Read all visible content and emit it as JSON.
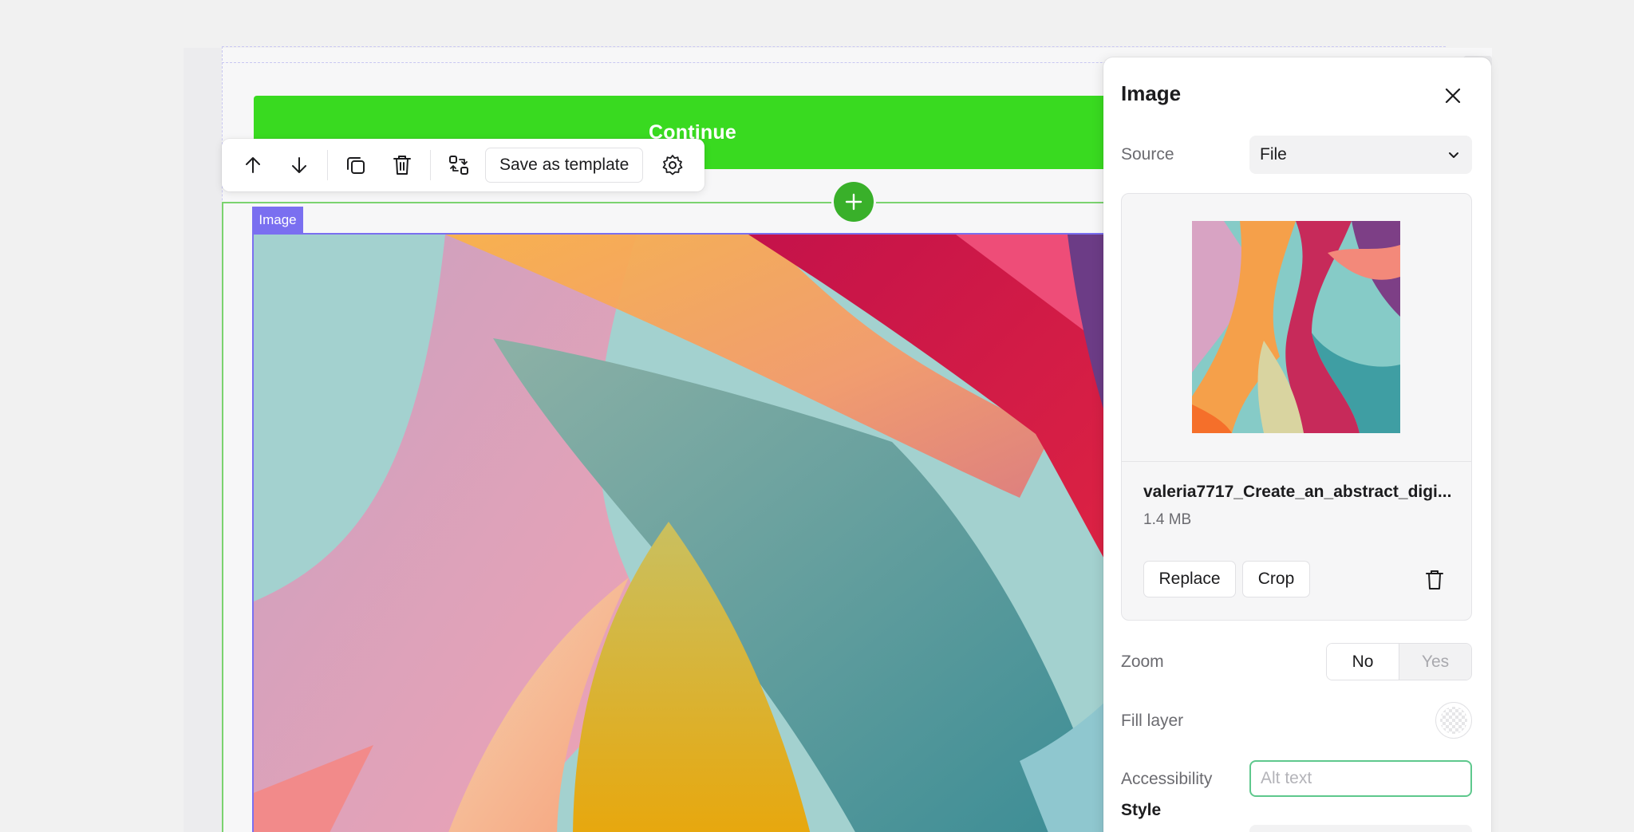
{
  "canvas": {
    "continue_label": "Continue",
    "image_tag": "Image"
  },
  "toolbar": {
    "save_template_label": "Save as template",
    "icons": [
      "arrow-up-icon",
      "arrow-down-icon",
      "duplicate-icon",
      "trash-icon",
      "swap-icon",
      "gear-icon"
    ]
  },
  "panel": {
    "title": "Image",
    "source_label": "Source",
    "source_value": "File",
    "file": {
      "name": "valeria7717_Create_an_abstract_digi...",
      "size": "1.4 MB",
      "replace_label": "Replace",
      "crop_label": "Crop"
    },
    "zoom_label": "Zoom",
    "zoom_options": [
      "No",
      "Yes"
    ],
    "zoom_selected": "No",
    "fill_layer_label": "Fill layer",
    "accessibility_label": "Accessibility",
    "alt_text_placeholder": "Alt text",
    "alt_text_value": "",
    "style_label": "Style"
  },
  "colors": {
    "accent_green": "#39da20",
    "add_button_green": "#39b02a",
    "selection_purple": "#7a6ff0",
    "input_focus": "#5ec88d"
  }
}
